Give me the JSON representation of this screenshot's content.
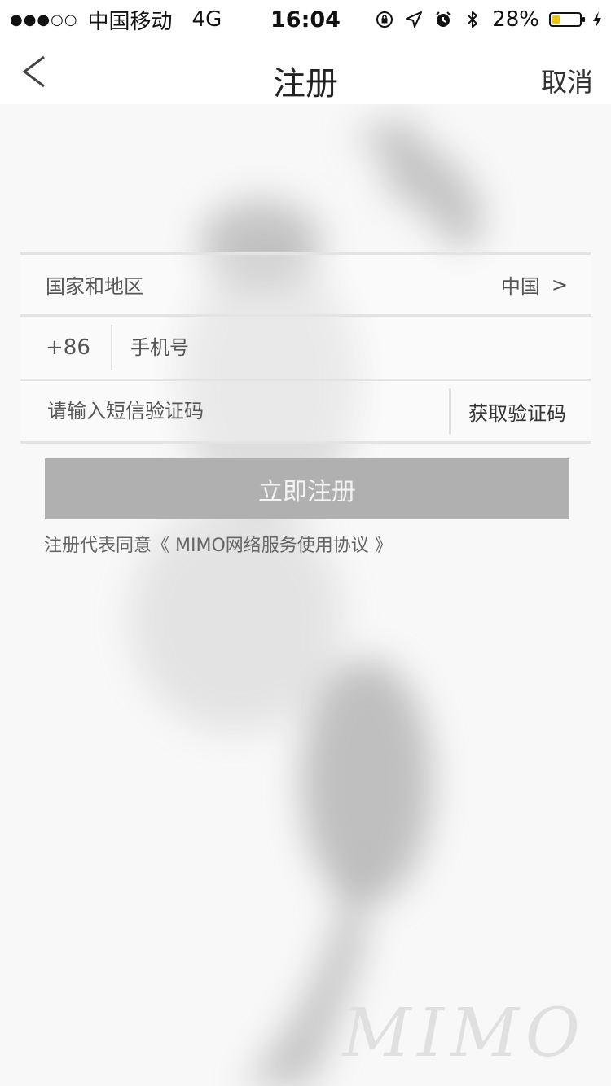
{
  "status_bar": {
    "signal_dots": "●●●○○",
    "carrier": "中国移动",
    "network": "4G",
    "time": "16:04",
    "battery_percent": "28%",
    "battery_level": 0.28,
    "battery_color": "#f4c400",
    "icons": [
      "rotation-lock-icon",
      "location-icon",
      "alarm-icon",
      "bluetooth-icon",
      "battery-icon",
      "charging-icon"
    ]
  },
  "nav": {
    "back_icon": "chevron-left-icon",
    "title": "注册",
    "cancel_label": "取消"
  },
  "form": {
    "region_label": "国家和地区",
    "region_value": "中国",
    "region_chevron": ">",
    "country_code": "+86",
    "phone_placeholder": "手机号",
    "code_placeholder": "请输入短信验证码",
    "get_code_label": "获取验证码"
  },
  "register_button": {
    "label": "立即注册",
    "color": "#b0b0b0"
  },
  "agreement_text": "注册代表同意《 MIMO网络服务使用协议 》",
  "watermark": "MIMO"
}
